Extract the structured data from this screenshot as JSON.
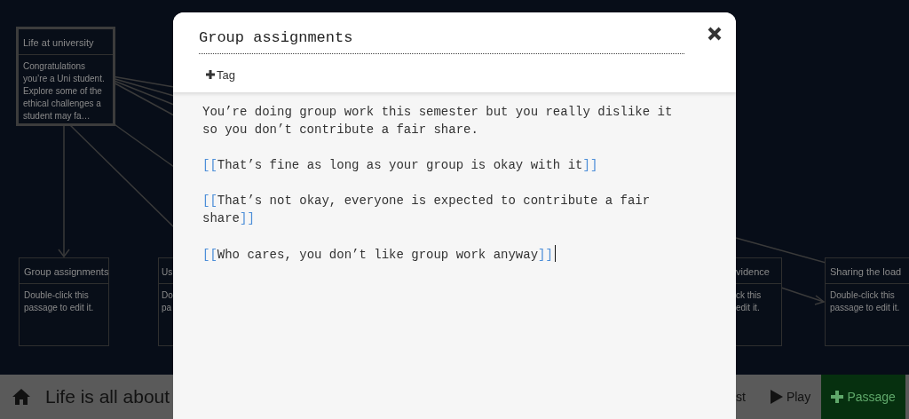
{
  "story_map": {
    "passages": [
      {
        "title": "Life at university",
        "excerpt_lines": [
          "Congratulations",
          "you’re a Uni student.",
          "Explore some of the",
          "ethical challenges a",
          "student may fa…"
        ],
        "selected": true
      },
      {
        "title": "Group assignments",
        "excerpt_lines": [
          "Double-click this",
          "passage to edit it."
        ],
        "selected": false
      },
      {
        "title": "Us",
        "excerpt_lines": [
          "Do",
          "pa"
        ],
        "selected": false
      },
      {
        "title": "vidence",
        "excerpt_lines": [
          "ck this",
          "edit it."
        ],
        "selected": false
      },
      {
        "title": "Sharing the load",
        "excerpt_lines": [
          "Double-click this",
          "passage to edit it."
        ],
        "selected": false
      }
    ]
  },
  "toolbar": {
    "story_title": "Life is all about",
    "items": [
      {
        "kind": "text",
        "label": "st"
      },
      {
        "kind": "play",
        "label": "Play"
      }
    ],
    "add_button": "Passage"
  },
  "dialog": {
    "title_value": "Group assignments",
    "tag_button": "Tag",
    "paragraphs": [
      {
        "kind": "text",
        "text": "You’re doing group work this semester but you really dislike it so you don’t contribute a fair share."
      },
      {
        "kind": "link",
        "open": "[[",
        "text": "That’s fine as long as your group is okay with it",
        "close": "]]"
      },
      {
        "kind": "link",
        "open": "[[",
        "text": "That’s not okay, everyone is expected to contribute a fair share",
        "close": "]]"
      },
      {
        "kind": "link",
        "open": "[[",
        "text": "Who cares, you don’t like group work anyway",
        "close": "]]"
      }
    ],
    "cursor": true
  }
}
